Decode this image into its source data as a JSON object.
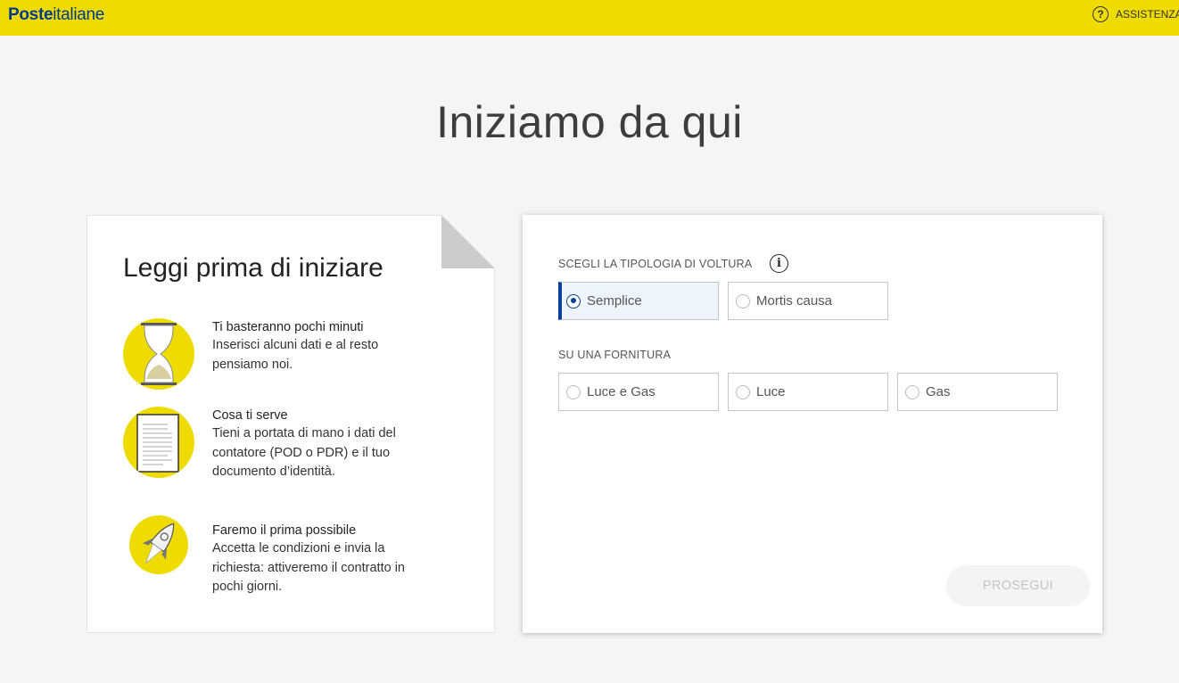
{
  "header": {
    "logo_bold": "Poste",
    "logo_light": "italiane",
    "help_icon": "question-circle-icon",
    "help_label": "ASSISTENZA",
    "bg_color": "#eedc00"
  },
  "page_title": "Iniziamo da qui",
  "info_card": {
    "title": "Leggi prima di iniziare",
    "items": [
      {
        "icon": "hourglass-icon",
        "head": "Ti basteranno pochi minuti",
        "lines": [
          "Inserisci alcuni dati e al resto",
          "pensiamo noi."
        ]
      },
      {
        "icon": "document-icon",
        "head": "Cosa ti serve",
        "lines": [
          "Tieni a portata di mano i dati del",
          "contatore (POD o PDR) e il tuo",
          "documento d’identità."
        ]
      },
      {
        "icon": "rocket-icon",
        "head": "Faremo il prima possibile",
        "lines": [
          "Accetta le condizioni e invia la",
          "richiesta: attiveremo il contratto in",
          "pochi giorni."
        ]
      }
    ]
  },
  "form": {
    "tipologia": {
      "label": "SCEGLI LA TIPOLOGIA DI VOLTURA",
      "info_icon": "info-icon",
      "info_glyph": "i",
      "options": [
        {
          "label": "Semplice",
          "selected": true
        },
        {
          "label": "Mortis causa",
          "selected": false
        }
      ]
    },
    "fornitura": {
      "label": "SU UNA FORNITURA",
      "options": [
        {
          "label": "Luce e Gas",
          "selected": false
        },
        {
          "label": "Luce",
          "selected": false
        },
        {
          "label": "Gas",
          "selected": false
        }
      ]
    },
    "submit_label": "PROSEGUI"
  },
  "colors": {
    "accent_yellow": "#eedc00",
    "brand_blue": "#003a8c",
    "selected_blue": "#0c3f96"
  }
}
